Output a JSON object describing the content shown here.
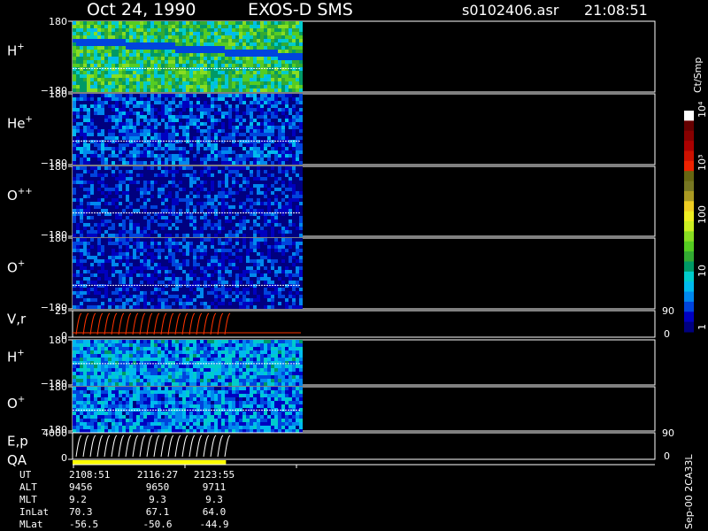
{
  "header": {
    "date": "Oct 24, 1990",
    "mission": "EXOS-D SMS",
    "file": "s0102406.asr",
    "time": "21:08:51"
  },
  "colorbar": {
    "unit": "Ct/Smp",
    "tick_labels": [
      "1",
      "10",
      "100",
      "10³",
      "10⁴"
    ],
    "tick_values": [
      1,
      10,
      100,
      1000,
      10000
    ],
    "colors": [
      "#00007f",
      "#0000c0",
      "#0044dd",
      "#0088ee",
      "#00bbee",
      "#00cccc",
      "#009966",
      "#33aa33",
      "#55cc22",
      "#88dd22",
      "#ccee22",
      "#eeee22",
      "#eecc22",
      "#aa9922",
      "#777722",
      "#666611",
      "#ee2200",
      "#cc1100",
      "#aa0000",
      "#880000",
      "#660000",
      "#ffffff"
    ]
  },
  "footer": {
    "version": "Sep-00 2CA33L",
    "rows": [
      {
        "label": "UT",
        "values": [
          "2108:51",
          "2116:27",
          "2123:55"
        ]
      },
      {
        "label": "ALT",
        "values": [
          "9456",
          "9650",
          "9711"
        ]
      },
      {
        "label": "MLT",
        "values": [
          "9.2",
          "9.3",
          "9.3"
        ]
      },
      {
        "label": "InLat",
        "values": [
          "70.3",
          "67.1",
          "64.0"
        ]
      },
      {
        "label": "MLat",
        "values": [
          "-56.5",
          "-50.6",
          "-44.9"
        ]
      }
    ]
  },
  "chart_data": {
    "type": "heatmap",
    "x_ticks": [
      "2108:51",
      "2116:27",
      "2123:55"
    ],
    "panels": [
      {
        "id": "h-plus-1",
        "label": "H",
        "sup": "+",
        "ylim": [
          -180,
          180
        ],
        "y_tick_labels": [
          "180",
          "−180"
        ],
        "level": 0.65,
        "line": -60,
        "beam": true
      },
      {
        "id": "he-plus",
        "label": "He",
        "sup": "+",
        "ylim": [
          -180,
          180
        ],
        "y_tick_labels": [
          "180",
          "−180"
        ],
        "level": 0.18,
        "line": -60
      },
      {
        "id": "o-plus-plus",
        "label": "O",
        "sup": "++",
        "ylim": [
          -180,
          180
        ],
        "y_tick_labels": [
          "180",
          "−180"
        ],
        "level": 0.1,
        "line": -60
      },
      {
        "id": "o-plus-1",
        "label": "O",
        "sup": "+",
        "ylim": [
          -180,
          180
        ],
        "y_tick_labels": [
          "180",
          "−180"
        ],
        "level": 0.12,
        "line": -60
      },
      {
        "id": "v-r",
        "label": "V,r",
        "sup": "",
        "type": "line",
        "ylim": [
          0,
          25
        ],
        "y_tick_labels": [
          "25",
          "0"
        ],
        "right_tick_labels": [
          "90",
          "0"
        ]
      },
      {
        "id": "h-plus-2",
        "label": "H",
        "sup": "+",
        "ylim": [
          -180,
          180
        ],
        "y_tick_labels": [
          "180",
          "−180"
        ],
        "level": 0.35,
        "line": -10
      },
      {
        "id": "o-plus-2",
        "label": "O",
        "sup": "+",
        "ylim": [
          -180,
          180
        ],
        "y_tick_labels": [
          "180",
          "−180"
        ],
        "level": 0.3,
        "line": -10
      },
      {
        "id": "e-p",
        "label": "E,p",
        "sup": "",
        "type": "line",
        "ylim": [
          0,
          4000
        ],
        "y_tick_labels": [
          "4000",
          "0"
        ],
        "right_tick_labels": [
          "90",
          "0"
        ]
      }
    ],
    "qa": {
      "label": "QA",
      "color": "#ffff00",
      "coverage": 0.23
    }
  }
}
